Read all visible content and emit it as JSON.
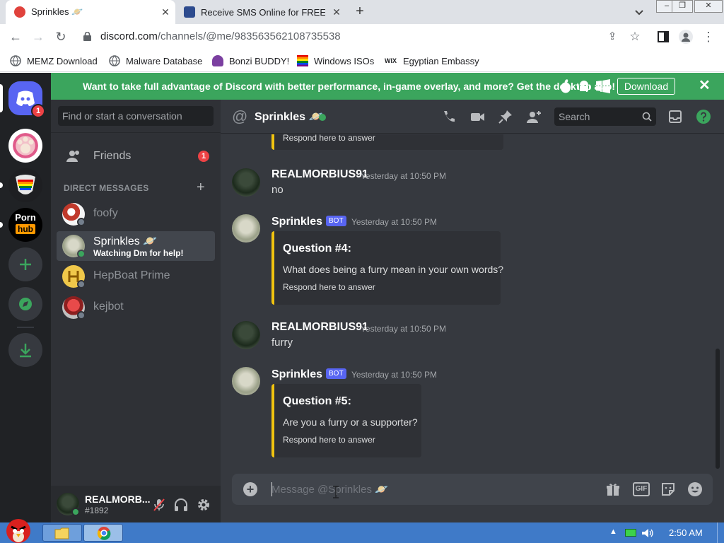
{
  "browser": {
    "tabs": [
      {
        "title": "Sprinkles 🪐",
        "close": "✕"
      },
      {
        "title": "Receive SMS Online for FREE |",
        "close": "✕"
      }
    ],
    "new_tab": "+",
    "url_host": "discord.com",
    "url_path": "/channels/@me/983563562108735538",
    "bookmarks": [
      "MEMZ Download",
      "Malware Database",
      "Bonzi BUDDY!",
      "Windows ISOs",
      "Egyptian Embassy"
    ],
    "bookmark_wix": "WIX"
  },
  "discord": {
    "banner": {
      "message": "Want to take full advantage of Discord with better performance, in-game overlay, and more? Get the desktop app!",
      "download": "Download",
      "close": "✕"
    },
    "server_rail": {
      "home_badge": "1",
      "porn_top": "Porn",
      "porn_bottom": "hub"
    },
    "search_placeholder": "Find or start a conversation",
    "friends": {
      "label": "Friends",
      "badge": "1"
    },
    "dm_header": "DIRECT MESSAGES",
    "dm_add": "+",
    "dms": [
      {
        "name": "foofy"
      },
      {
        "name": "Sprinkles 🪐",
        "status": "Watching Dm for help!"
      },
      {
        "name": "HepBoat Prime"
      },
      {
        "name": "kejbot"
      }
    ],
    "user": {
      "name": "REALMORB...",
      "tag": "#1892"
    },
    "channel": {
      "at": "@",
      "title": "Sprinkles 🪐",
      "search": "Search"
    },
    "messages": [
      {
        "kind": "embed_tail",
        "field": "Respond here to answer"
      },
      {
        "author": "REALMORBIUS91",
        "time": "Yesterday at 10:50 PM",
        "text": "no"
      },
      {
        "author": "Sprinkles 🪐",
        "bot": "BOT",
        "time": "Yesterday at 10:50 PM",
        "embed": {
          "title": "Question #4:",
          "description": "What does being a furry mean in your own words?",
          "field": "Respond here to answer"
        }
      },
      {
        "author": "REALMORBIUS91",
        "time": "Yesterday at 10:50 PM",
        "text": "furry"
      },
      {
        "author": "Sprinkles 🪐",
        "bot": "BOT",
        "time": "Yesterday at 10:50 PM",
        "embed": {
          "title": "Question #5:",
          "description": "Are you a furry or a supporter?",
          "field": "Respond here to answer"
        }
      }
    ],
    "composer_placeholder": "Message @Sprinkles 🪐",
    "gif": "GIF"
  },
  "taskbar": {
    "time": "2:50 AM"
  },
  "colors": {
    "discord_green": "#3ba55d",
    "blurple": "#5865f2",
    "embed_yellow": "#f1c40f",
    "mention_red": "#ed4245"
  }
}
